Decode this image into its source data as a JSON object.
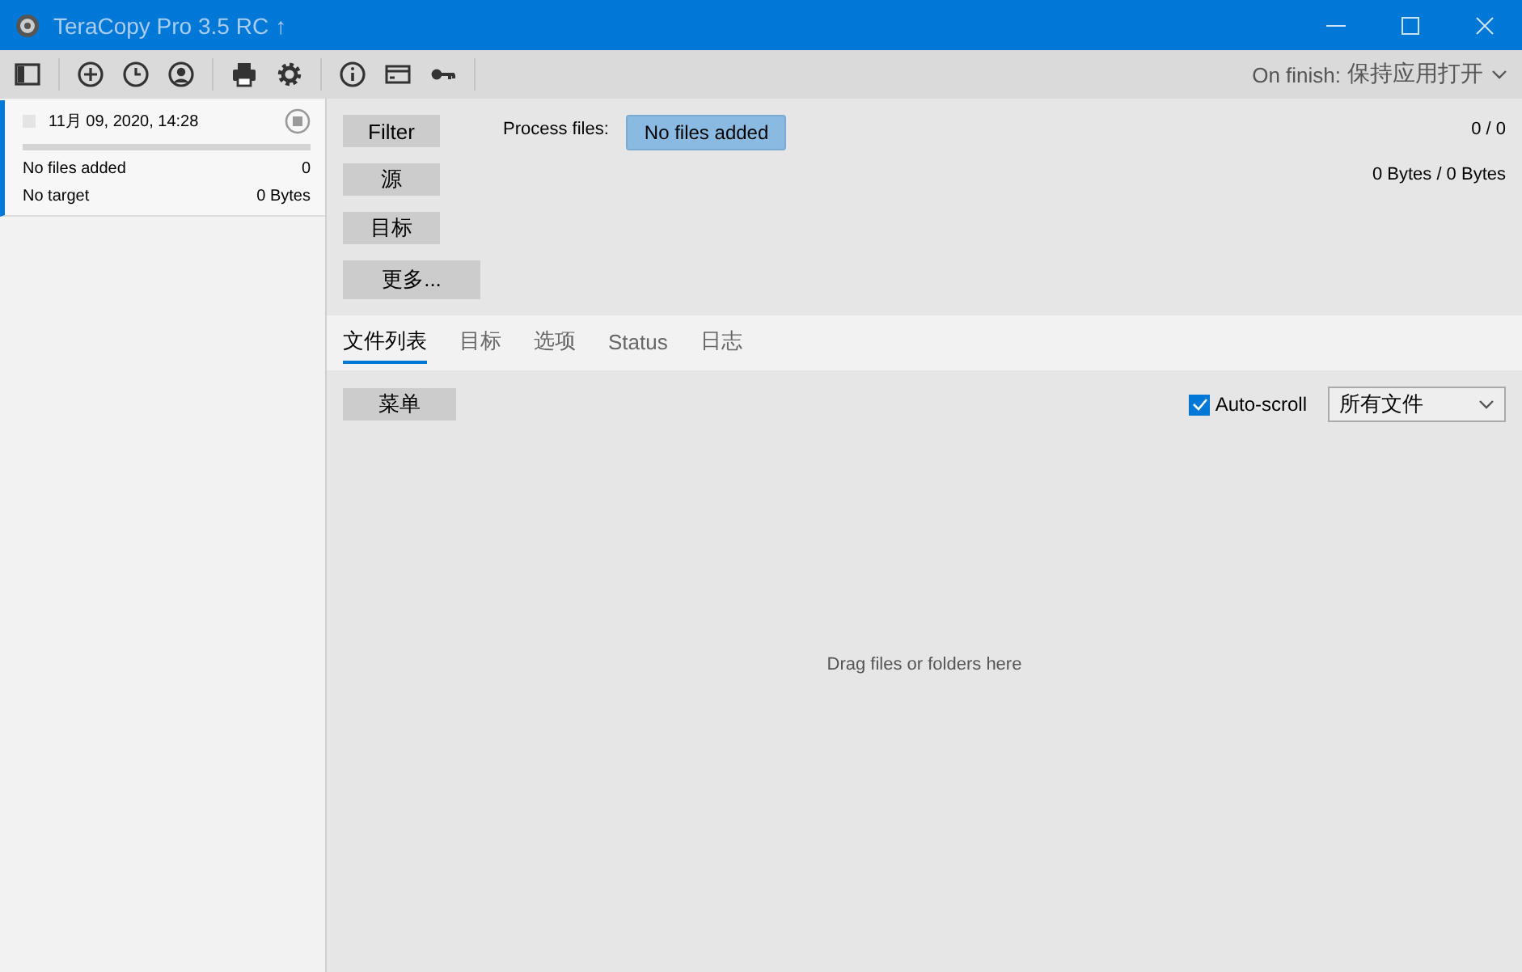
{
  "window": {
    "title": "TeraCopy Pro 3.5 RC",
    "title_glyph": "↑"
  },
  "toolbar": {
    "on_finish_label": "On finish:",
    "on_finish_value": "保持应用打开"
  },
  "sidebar": {
    "jobs": [
      {
        "date": "11月 09, 2020, 14:28",
        "selected": true,
        "level": 0,
        "files": "No files added",
        "count": "0",
        "target": "No target",
        "size": "0 Bytes"
      }
    ]
  },
  "panel": {
    "buttons": [
      {
        "label": "Filter"
      },
      {
        "label": "源"
      },
      {
        "label": "目标"
      },
      {
        "label": "更多..."
      }
    ],
    "process_label": "Process files:",
    "process_value": "No files added",
    "count": "0 / 0",
    "size": "0 Bytes / 0 Bytes"
  },
  "tabs": [
    {
      "label": "文件列表",
      "selected": true
    },
    {
      "label": "目标",
      "selected": false
    },
    {
      "label": "选项",
      "selected": false
    },
    {
      "label": "Status",
      "selected": false
    },
    {
      "label": "日志",
      "selected": false
    }
  ],
  "file_list": {
    "menu_button": "菜单",
    "auto_scroll": {
      "label": "Auto-scroll",
      "checked": true
    },
    "filter": {
      "value": "所有文件"
    },
    "drop_hint": "Drag files or folders here"
  }
}
